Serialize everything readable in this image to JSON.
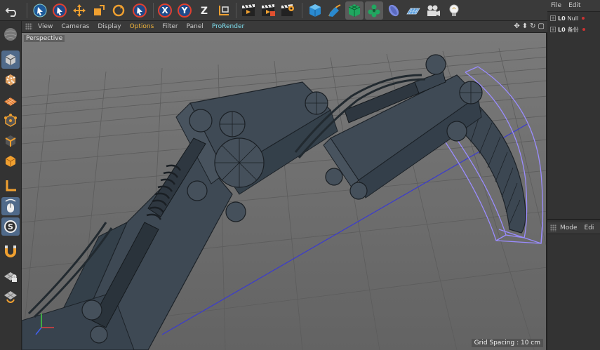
{
  "toolbar": {
    "icons": [
      "undo-icon",
      "live-selection-icon",
      "move-icon",
      "scale-icon",
      "rotate-icon",
      "last-tool-icon",
      "x-axis-icon",
      "y-axis-icon",
      "z-axis-icon",
      "coordinate-system-icon",
      "render-view-icon",
      "render-picture-viewer-icon",
      "render-settings-icon",
      "cube-icon",
      "pen-icon",
      "subdivision-icon",
      "array-icon",
      "deformer-icon",
      "floor-icon",
      "camera-icon",
      "light-icon"
    ],
    "z_label": "Z",
    "x_label": "X",
    "y_label": "Y"
  },
  "viewport": {
    "menu": {
      "view": "View",
      "cameras": "Cameras",
      "display": "Display",
      "options": "Options",
      "filter": "Filter",
      "panel": "Panel",
      "prorender": "ProRender"
    },
    "camera_label": "Perspective",
    "grid_spacing": "Grid Spacing : 10 cm",
    "nav_icons": [
      "✥",
      "⬍",
      "↻",
      "▢"
    ]
  },
  "object_manager": {
    "menu": {
      "file": "File",
      "edit": "Edit"
    },
    "objects": [
      {
        "layer": "L0",
        "name": "Null"
      },
      {
        "layer": "L0",
        "name": "备份"
      }
    ]
  },
  "attribute_manager": {
    "menu": {
      "mode": "Mode",
      "edit": "Edi"
    }
  },
  "colors": {
    "accent": "#f0b43c",
    "active_blue": "#506a8a",
    "viewport_bg": "#6d6d6d",
    "mesh": "#3a4550",
    "selection": "#9a8cff"
  }
}
